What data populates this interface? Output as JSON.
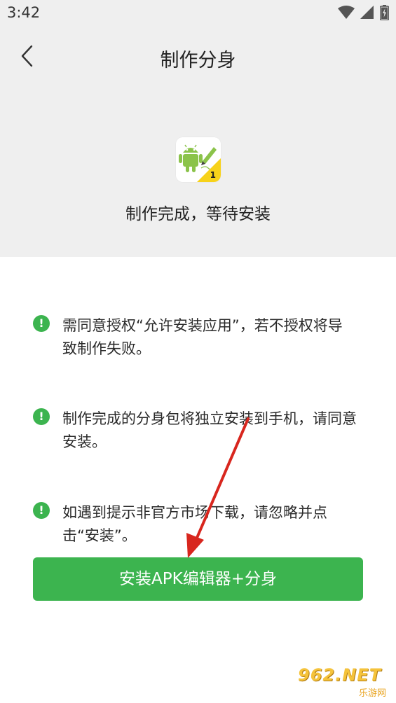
{
  "status_bar": {
    "time": "3:42",
    "icons": [
      "wifi-icon",
      "signal-icon",
      "battery-icon"
    ]
  },
  "header": {
    "title": "制作分身",
    "back_icon": "chevron-left-icon"
  },
  "app": {
    "icon": "android-app-editor-icon",
    "badge": "1",
    "status_message": "制作完成，等待安装"
  },
  "notices": [
    {
      "icon": "exclamation-icon",
      "text": "需同意授权“允许安装应用”，若不授权将导致制作失败。"
    },
    {
      "icon": "exclamation-icon",
      "text": "制作完成的分身包将独立安装到手机，请同意安装。"
    },
    {
      "icon": "exclamation-icon",
      "text": "如遇到提示非官方市场下载，请忽略并点击“安装”。"
    }
  ],
  "install_button": {
    "label": "安装APK编辑器+分身"
  },
  "watermark": {
    "text": "962.NET",
    "sub": "乐游网"
  },
  "colors": {
    "accent": "#3cb44f",
    "header_bg": "#efefef",
    "annotation_arrow": "#d8261e"
  }
}
